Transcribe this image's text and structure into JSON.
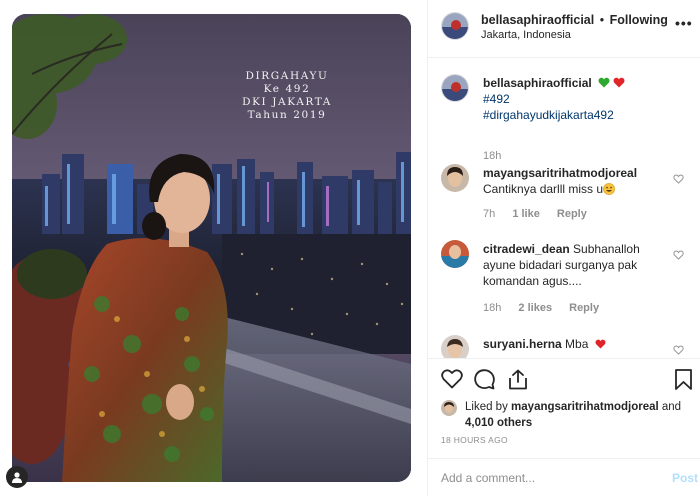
{
  "post": {
    "overlay_lines": [
      "DIRGAHAYU",
      "Ke 492",
      "DKI JAKARTA",
      "Tahun 2019"
    ]
  },
  "header": {
    "username": "bellasaphiraofficial",
    "separator": "•",
    "follow_status": "Following",
    "location": "Jakarta, Indonesia",
    "more": "•••"
  },
  "caption": {
    "username": "bellasaphiraofficial",
    "emojis": [
      "green-heart",
      "red-heart"
    ],
    "hashtags": [
      "#492",
      "#dirgahayudkijakarta492"
    ],
    "time": "18h"
  },
  "comments": [
    {
      "username": "mayangsaritrihatmodjoreal",
      "text": "Cantiknya darlll miss u",
      "emoji": "grinning-face",
      "time": "7h",
      "likes": "1 like",
      "reply": "Reply"
    },
    {
      "username": "citradewi_dean",
      "text": "Subhanalloh ayune bidadari surganya pak komandan agus....",
      "time": "18h",
      "likes": "2 likes",
      "reply": "Reply"
    },
    {
      "username": "suryani.herna",
      "text": "Mba",
      "emoji": "red-heart"
    }
  ],
  "actions": {
    "liked_by_prefix": "Liked by",
    "liked_by_user": "mayangsaritrihatmodjoreal",
    "liked_and": "and",
    "liked_count": "4,010 others",
    "timestamp": "18 HOURS AGO"
  },
  "add_comment": {
    "placeholder": "Add a comment...",
    "post_label": "Post"
  },
  "colors": {
    "link": "#00376b",
    "muted": "#8e8e8e",
    "post_disabled": "#b2dffc",
    "border": "#efefef"
  }
}
